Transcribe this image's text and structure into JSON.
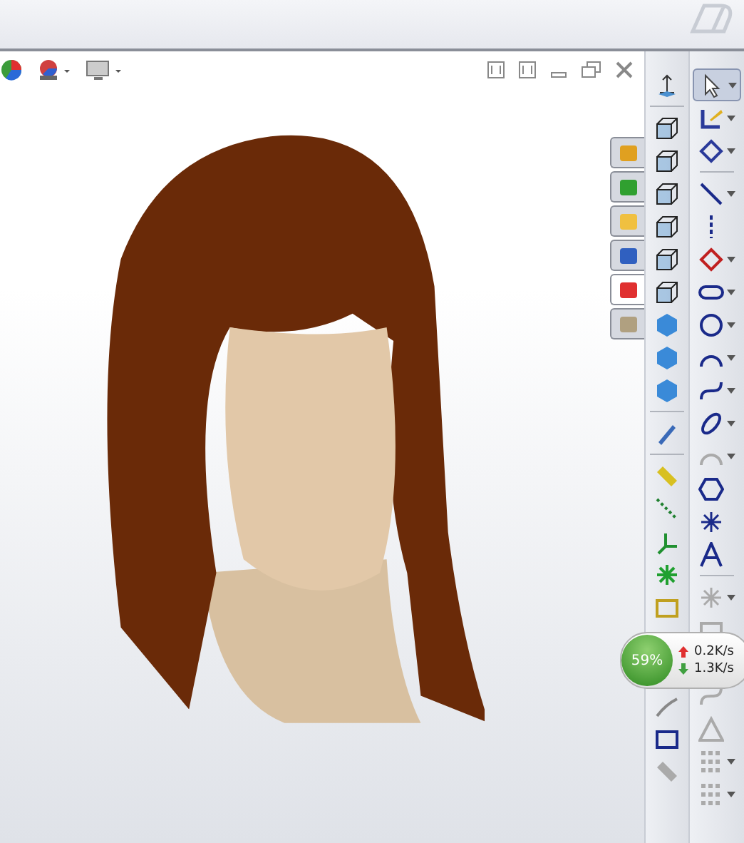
{
  "task_pane_tabs": [
    {
      "selected": false
    },
    {
      "selected": false
    },
    {
      "selected": false
    },
    {
      "selected": false
    },
    {
      "selected": true
    },
    {
      "selected": false
    }
  ],
  "network_widget": {
    "percent": "59%",
    "upload": "0.2K/s",
    "download": "1.3K/s"
  }
}
